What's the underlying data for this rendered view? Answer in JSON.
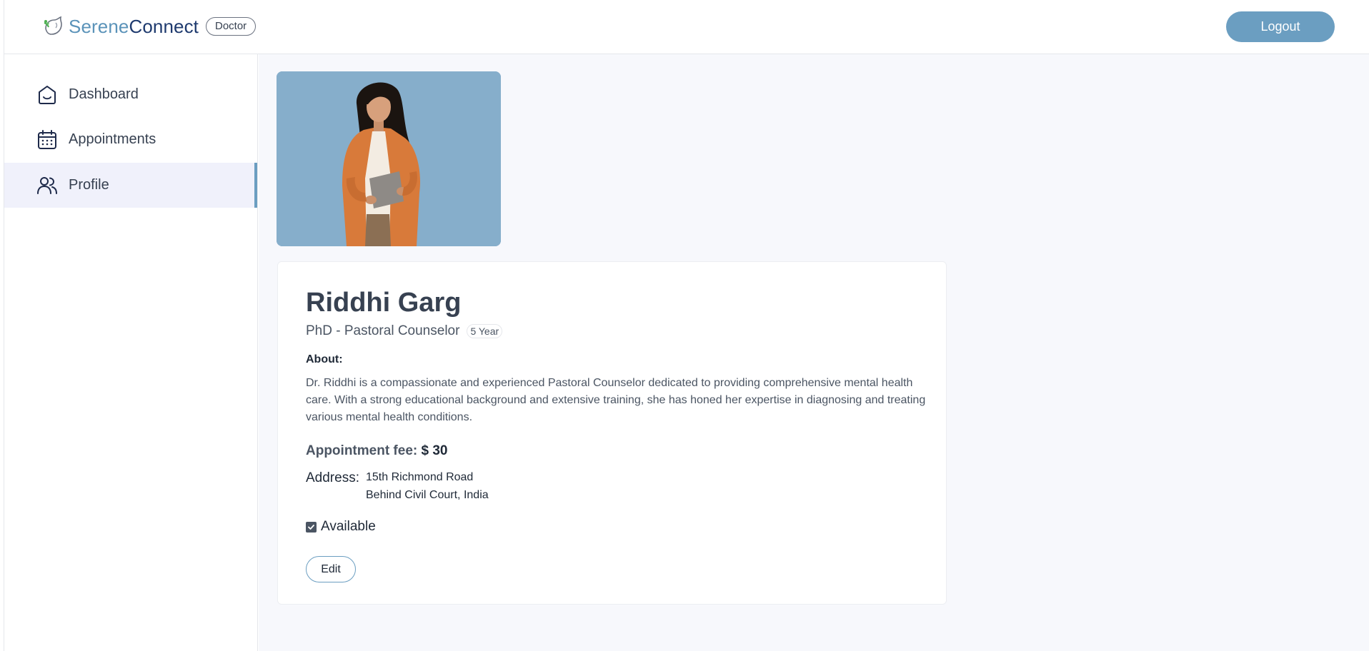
{
  "header": {
    "brand_part1": "Serene",
    "brand_part2": "Connect",
    "role_badge": "Doctor",
    "logout_label": "Logout",
    "logo_icon": "dove-icon"
  },
  "sidebar": {
    "items": [
      {
        "label": "Dashboard",
        "icon": "home-icon",
        "active": false
      },
      {
        "label": "Appointments",
        "icon": "calendar-icon",
        "active": false
      },
      {
        "label": "Profile",
        "icon": "people-icon",
        "active": true
      }
    ]
  },
  "profile": {
    "name": "Riddhi Garg",
    "degree": "PhD - Pastoral Counselor",
    "experience": "5 Year",
    "about_label": "About:",
    "about_text": "Dr. Riddhi is a compassionate and experienced Pastoral Counselor dedicated to providing comprehensive mental health care. With a strong educational background and extensive training, she has honed her expertise in diagnosing and treating various mental health conditions.",
    "fee_label": "Appointment fee:",
    "fee_value": "$ 30",
    "address_label": "Address:",
    "address_line1": "15th Richmond Road",
    "address_line2": "Behind Civil Court, India",
    "available_label": "Available",
    "available": true,
    "edit_label": "Edit"
  },
  "colors": {
    "accent": "#6b9ec1",
    "photo_bg": "#86aecb",
    "active_nav_bg": "#f0f1fb"
  }
}
